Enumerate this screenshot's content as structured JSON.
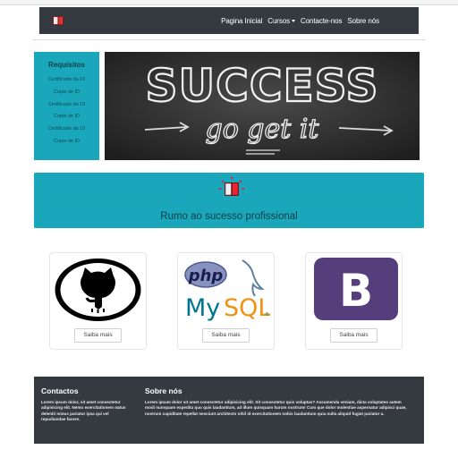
{
  "nav": {
    "brand_icon": "book-icon",
    "links": [
      "Pagina Inicial",
      "Cursos",
      "Contacte-nos",
      "Sobre nós"
    ]
  },
  "requisitos": {
    "title": "Requisitos",
    "items": [
      "Certificado da 10",
      "Copia de ID",
      "Certificado da 10",
      "Copia de ID",
      "Certificado da 10",
      "Copia de ID"
    ]
  },
  "hero": {
    "alt_words": [
      "SUCCESS",
      "go get it"
    ]
  },
  "banner": {
    "icon": "book-icon",
    "text": "Rumo ao sucesso profissional"
  },
  "cards": [
    {
      "logo": "github-icon",
      "button": "Saiba mais"
    },
    {
      "logo": "php-mysql-icon",
      "button": "Saiba mais"
    },
    {
      "logo": "bootstrap-icon",
      "button": "Saiba mais"
    }
  ],
  "footer": {
    "contactos_title": "Contactos",
    "contactos_text": "Lorem ipsum dolor, sit amet consectetur adipisicing elit. Nemo exercitationem natus deleniti minus pariatur ipsa qui vel repudiandae facere.",
    "sobre_title": "Sobre nós",
    "sobre_text": "Lorem ipsum dolor sit amet consectetur adipisicing elit. Sit consectetur quis voluptas? Assumenda veniam, dicta voluptates autem modi numquam expedita quo quis laudantium, ad illum quisquam harum nostrum! Cum que dolor molestiae aspernatur adipisci quae, nostrum cupiditate repellat nesciunt architecto nihil id exercitationem nobis laudantium quia nulla aliquid fugiat pariatur a."
  },
  "colors": {
    "navbar": "#343a40",
    "teal": "#1aa7bb",
    "bootstrap_purple": "#563d7c"
  }
}
